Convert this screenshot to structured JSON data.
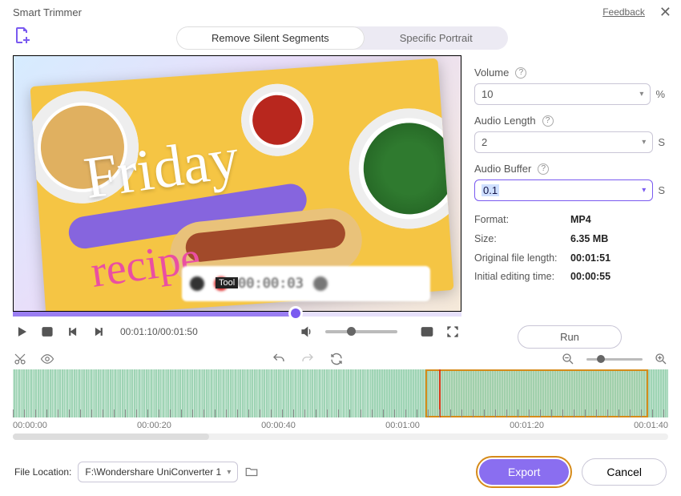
{
  "titlebar": {
    "title": "Smart Trimmer",
    "feedback": "Feedback"
  },
  "tabs": {
    "remove_silent": "Remove Silent Segments",
    "specific_portrait": "Specific Portrait"
  },
  "preview": {
    "cursive1": "Friday",
    "cursive2": "recipe",
    "sub_time": "00:00:03",
    "tool_tag": "Tool"
  },
  "playbar": {
    "timecode": "00:01:10/00:01:50"
  },
  "sidebar": {
    "volume_label": "Volume",
    "volume_value": "10",
    "volume_unit": "%",
    "audio_length_label": "Audio Length",
    "audio_length_value": "2",
    "audio_length_unit": "S",
    "audio_buffer_label": "Audio Buffer",
    "audio_buffer_value": "0.1",
    "audio_buffer_unit": "S",
    "format_label": "Format:",
    "format_value": "MP4",
    "size_label": "Size:",
    "size_value": "6.35 MB",
    "orig_len_label": "Original file length:",
    "orig_len_value": "00:01:51",
    "init_edit_label": "Initial editing time:",
    "init_edit_value": "00:00:55",
    "run": "Run"
  },
  "timeline": {
    "ticks": [
      "00:00:00",
      "00:00:20",
      "00:00:40",
      "00:01:00",
      "00:01:20",
      "00:01:40"
    ]
  },
  "footer": {
    "file_loc_label": "File Location:",
    "file_loc_value": "F:\\Wondershare UniConverter 1",
    "export": "Export",
    "cancel": "Cancel"
  }
}
